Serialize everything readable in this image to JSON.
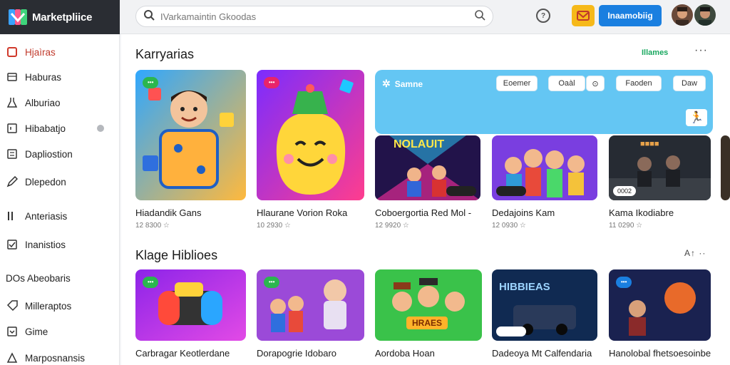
{
  "app": {
    "title": "Marketpliice"
  },
  "search": {
    "placeholder": "IVarkamaintin Gkoodas"
  },
  "header": {
    "primary_label": "Inaamobiig"
  },
  "sidebar": {
    "items": [
      {
        "label": "Hjaìras",
        "icon": "square-icon"
      },
      {
        "label": "Haburas",
        "icon": "cart-icon"
      },
      {
        "label": "Alburiao",
        "icon": "flask-icon"
      },
      {
        "label": "Hibabatjo",
        "icon": "box-icon"
      },
      {
        "label": "Dapliostion",
        "icon": "grid-icon"
      },
      {
        "label": "Dlepedon",
        "icon": "pencil-icon"
      },
      {
        "label": "Anteriasis",
        "icon": "bars-icon"
      },
      {
        "label": "Inanistios",
        "icon": "check-icon"
      },
      {
        "label": "DOs Abeobaris",
        "icon": "none"
      },
      {
        "label": "Milleraptos",
        "icon": "tag-icon"
      },
      {
        "label": "Gime",
        "icon": "chevron-icon"
      },
      {
        "label": "Marposnansis",
        "icon": "check-icon"
      }
    ]
  },
  "section1": {
    "title": "Karryarias",
    "link": "Illames",
    "more": "···",
    "cards": [
      {
        "title": "Hiadandik Gans",
        "meta": "12 8300",
        "tag": ""
      },
      {
        "title": "Hlaurane Vorion Roka",
        "meta": "10 2930",
        "tag": ""
      },
      {
        "title": "Coboergortia Red Mol  -",
        "meta": "12 9920",
        "thumb_text": "NOLAUIT"
      },
      {
        "title": "Dedajoins Kam",
        "meta": "12 0930"
      },
      {
        "title": "Kama Ikodiabre",
        "meta": "11 0290",
        "thumb_text": "0002"
      }
    ],
    "promo": {
      "title": "Samne",
      "chips": [
        "Eoemer",
        "Oaàl",
        "Faoden",
        "Daw"
      ]
    }
  },
  "section2": {
    "title": "Klage Hiblioes",
    "more": "A↑ ··",
    "cards": [
      {
        "title": "Carbragar Keotlerdane",
        "meta": ""
      },
      {
        "title": "Dorapogrie Idobaro",
        "meta": ""
      },
      {
        "title": "Aordoba Hoan",
        "meta": "",
        "thumb_text": "HRAES"
      },
      {
        "title": "Dadeoya Mt Calfendaria",
        "meta": "",
        "thumb_text": "HIBBIEAS"
      },
      {
        "title": "Hanolobal fhetsoesoinbe",
        "meta": ""
      }
    ]
  },
  "colors": {
    "accent": "#1a7fe0",
    "brand_bg": "#2a2d33",
    "promo": "#64c6f3",
    "link": "#1aa860"
  }
}
